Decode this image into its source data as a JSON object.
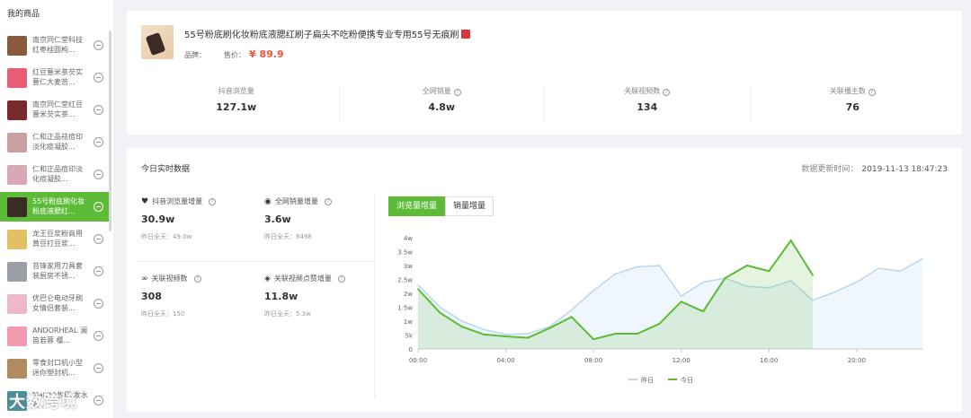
{
  "sidebar": {
    "title": "我的商品",
    "items": [
      {
        "label": "南京同仁堂科技红枣桂圆枸...",
        "color": "#8b5a3c"
      },
      {
        "label": "红豆薏米茶芡实薏仁大麦苦...",
        "color": "#e85d75"
      },
      {
        "label": "南京同仁堂红豆薏米芡实茶...",
        "color": "#7a2a2a"
      },
      {
        "label": "仁和正品祛痘印淡化痘凝胶...",
        "color": "#c9a0a0"
      },
      {
        "label": "仁和正品痘印淡化痘凝胶...",
        "color": "#d8a9b5"
      },
      {
        "label": "55号粉底刷化妆粉底液腮红...",
        "color": "#3a2b25"
      },
      {
        "label": "龙王豆浆粉商用黄豆打豆浆...",
        "color": "#e0c060"
      },
      {
        "label": "苔锋家用刀具套装厨房不锈...",
        "color": "#9aa0a6"
      },
      {
        "label": "优巴仑电动牙刷女情侣套装...",
        "color": "#f0b7c8"
      },
      {
        "label": "ANDORHEAL 澜笛若蓉 樱...",
        "color": "#f29bb0"
      },
      {
        "label": "零食封口机小型迷你塑封机...",
        "color": "#b28a60"
      },
      {
        "label": "MakitA牧田 发水泵...",
        "color": "#4a8f9a"
      }
    ],
    "active_index": 5,
    "watermark": "大数跨境"
  },
  "product": {
    "title": "55号粉底刷化妆粉底液腮红刷子扁头不吃粉便携专业专用55号无痕刷",
    "brand_label": "品牌：",
    "price_label": "售价：",
    "price": "¥ 89.9",
    "stats": [
      {
        "label": "抖音浏览量",
        "value": "127.1w",
        "help": false
      },
      {
        "label": "全网销量",
        "value": "4.8w",
        "help": true
      },
      {
        "label": "关联视频数",
        "value": "134",
        "help": true
      },
      {
        "label": "关联播主数",
        "value": "76",
        "help": true
      }
    ]
  },
  "realtime": {
    "title": "今日实时数据",
    "update_label": "数据更新时间：",
    "update_time": "2019-11-13 18:47:23",
    "metrics": [
      {
        "label": "抖音浏览量增量",
        "value": "30.9w",
        "sub": "昨日全天：49.0w",
        "icon": "heart-icon"
      },
      {
        "label": "全网销量增量",
        "value": "3.6w",
        "sub": "昨日全天：8498",
        "icon": "eye-icon"
      },
      {
        "label": "关联视频数",
        "value": "308",
        "sub": "昨日全天：150",
        "icon": "link-icon"
      },
      {
        "label": "关联视频点赞增量",
        "value": "11.8w",
        "sub": "昨日全天：5.3w",
        "icon": "compass-icon"
      }
    ],
    "tabs": [
      "浏览量增量",
      "销量增量"
    ],
    "active_tab": 0
  },
  "chart_data": {
    "type": "area",
    "x": [
      "00:00",
      "01:00",
      "02:00",
      "03:00",
      "04:00",
      "05:00",
      "06:00",
      "07:00",
      "08:00",
      "09:00",
      "10:00",
      "11:00",
      "12:00",
      "13:00",
      "14:00",
      "15:00",
      "16:00",
      "17:00",
      "18:00",
      "19:00",
      "20:00",
      "21:00",
      "22:00",
      "23:00"
    ],
    "x_ticks": [
      "00:00",
      "04:00",
      "08:00",
      "12:00",
      "16:00",
      "20:00"
    ],
    "y_ticks": [
      "0",
      "5k",
      "1w",
      "1.5w",
      "2w",
      "2.5w",
      "3w",
      "3.5w",
      "4w"
    ],
    "ylim": [
      0,
      40000
    ],
    "series": [
      {
        "name": "昨日",
        "color": "#b8d8f0",
        "values": [
          23000,
          15000,
          10000,
          7000,
          5200,
          5500,
          8000,
          14000,
          21000,
          27000,
          29500,
          30000,
          19000,
          24000,
          25500,
          22500,
          22000,
          24500,
          17500,
          20500,
          24000,
          29000,
          28000,
          32500
        ]
      },
      {
        "name": "今日",
        "color": "#5dbb37",
        "values": [
          21500,
          13000,
          8000,
          5200,
          4500,
          4000,
          7500,
          11500,
          3500,
          5500,
          5500,
          9000,
          17000,
          13500,
          25500,
          30000,
          28000,
          39000,
          26500
        ]
      }
    ]
  }
}
